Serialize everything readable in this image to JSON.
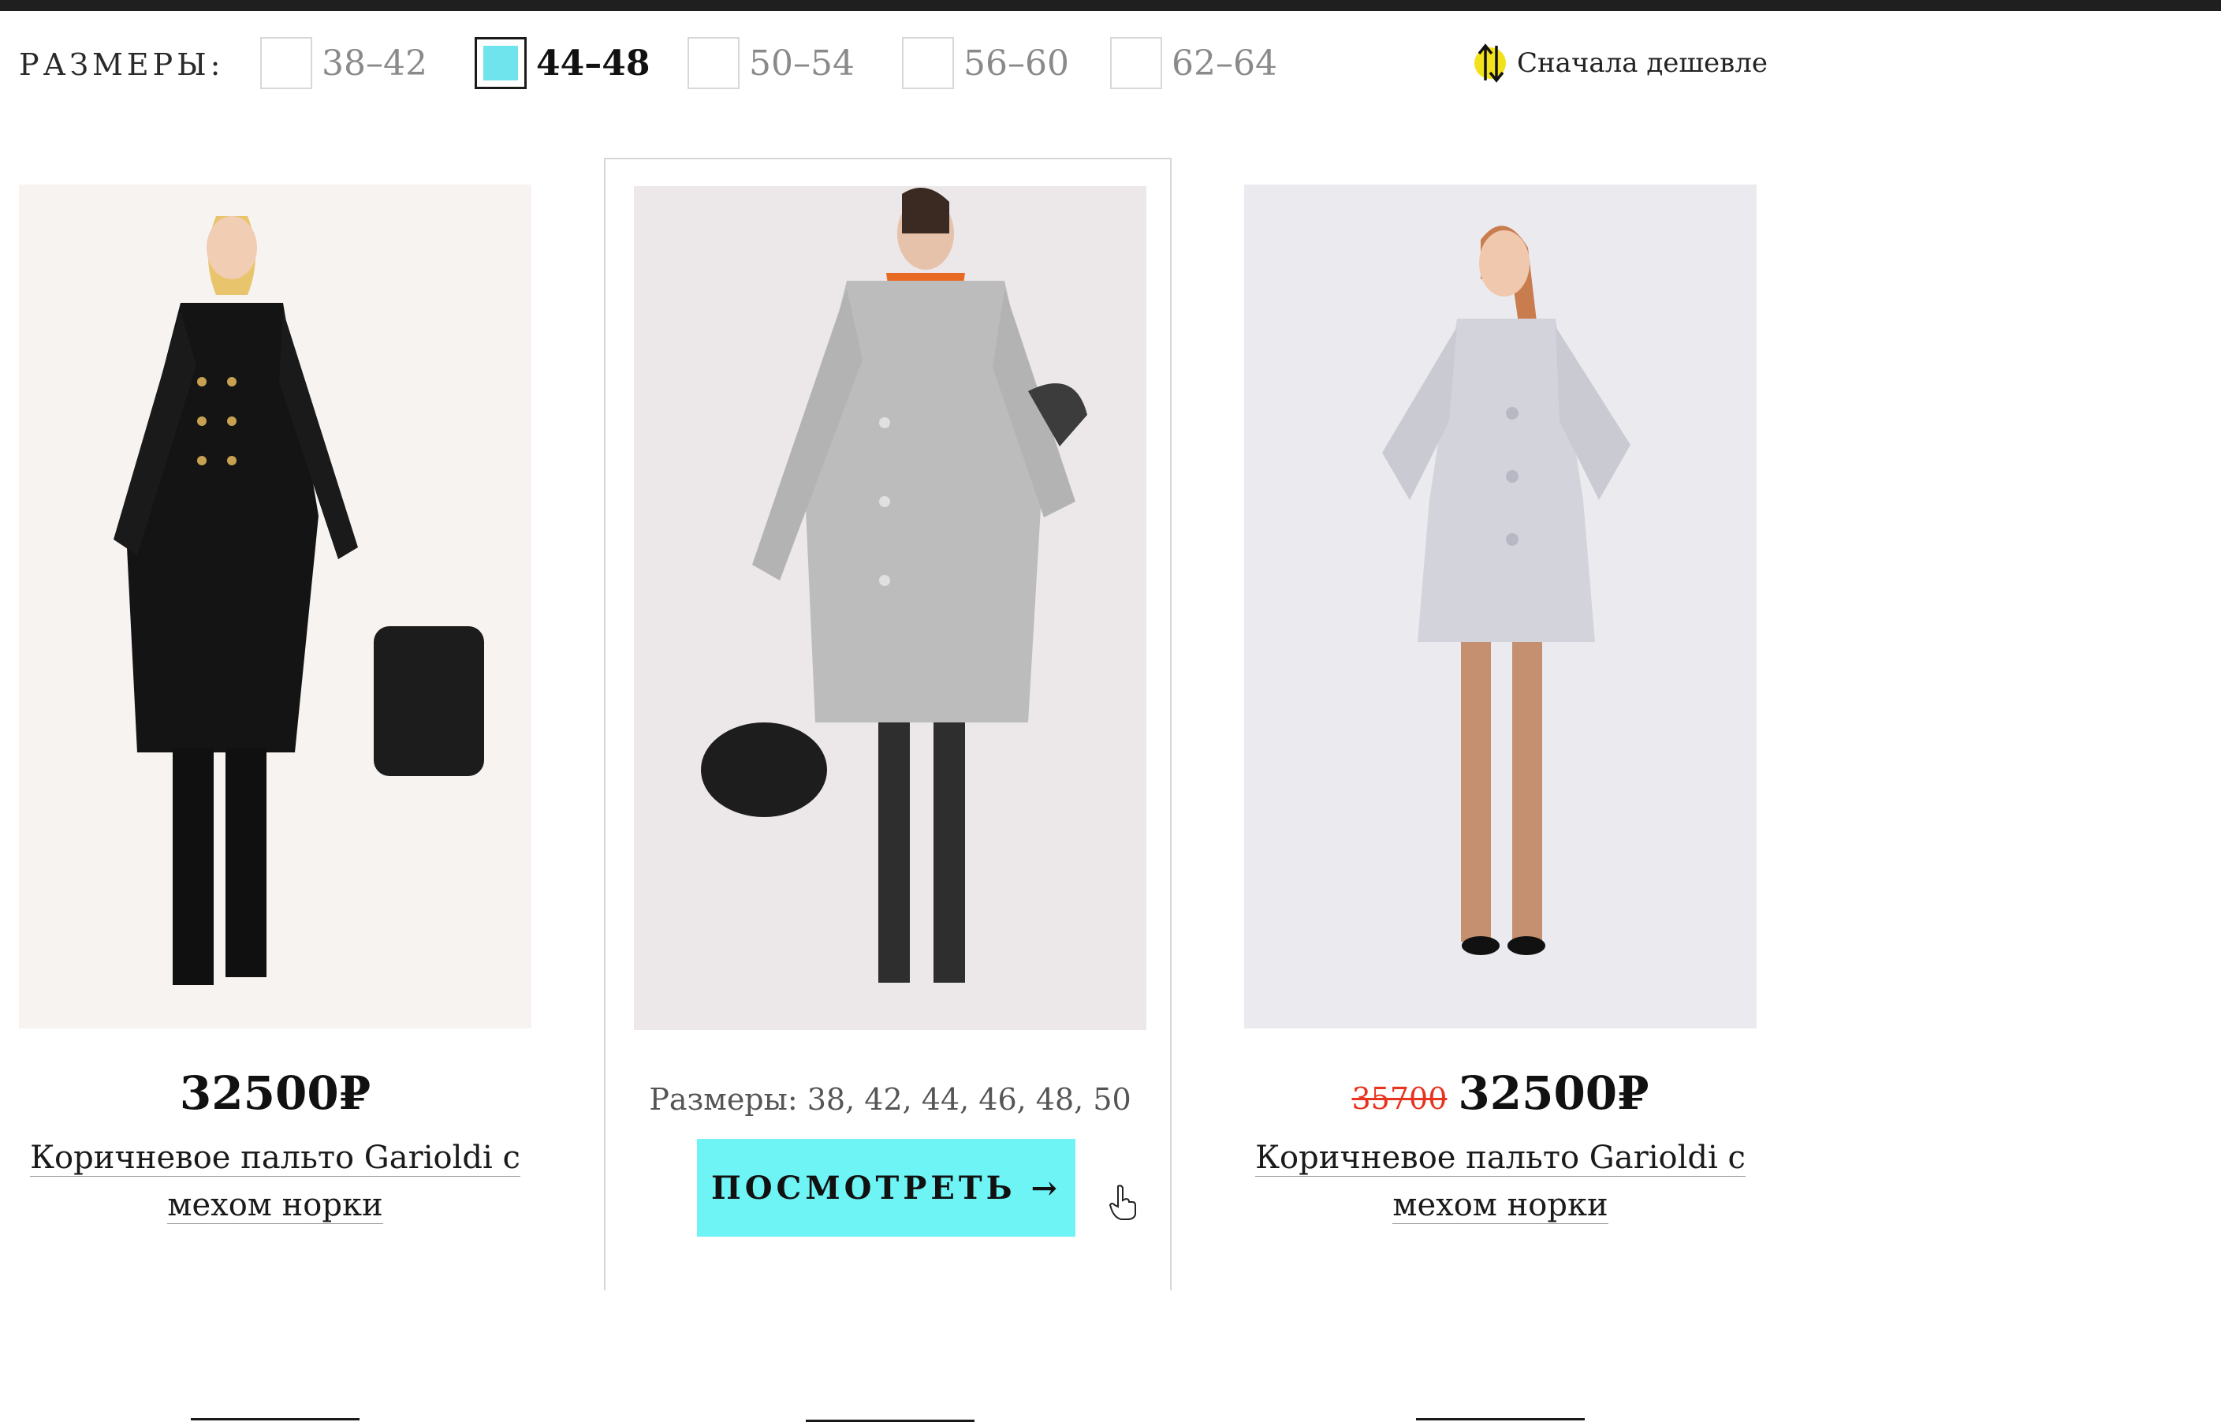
{
  "filters": {
    "label": "РАЗМЕРЫ:",
    "sizes": [
      {
        "label": "38–42",
        "checked": false
      },
      {
        "label": "44–48",
        "checked": true
      },
      {
        "label": "50–54",
        "checked": false
      },
      {
        "label": "56–60",
        "checked": false
      },
      {
        "label": "62–64",
        "checked": false
      }
    ],
    "checked_color": "#6fe4ec",
    "sort_label": "Сначала дешевле",
    "sort_icon": "sort-arrows-icon"
  },
  "products": [
    {
      "price": "32500₽",
      "name_line1": "Коричневое пальто Garioldi с",
      "name_line2": "мехом норки",
      "image": "black-coat-model-photo"
    },
    {
      "sizes": "Размеры: 38, 42, 44, 46, 48, 50",
      "button_label": "ПОСМОТРЕТЬ →",
      "button_color": "#6ff4f6",
      "image": "grey-coat-model-photo"
    },
    {
      "old_price": "35700",
      "price": "32500₽",
      "name_line1": "Коричневое пальто Garioldi с",
      "name_line2": "мехом норки",
      "image": "white-coat-model-photo"
    }
  ]
}
